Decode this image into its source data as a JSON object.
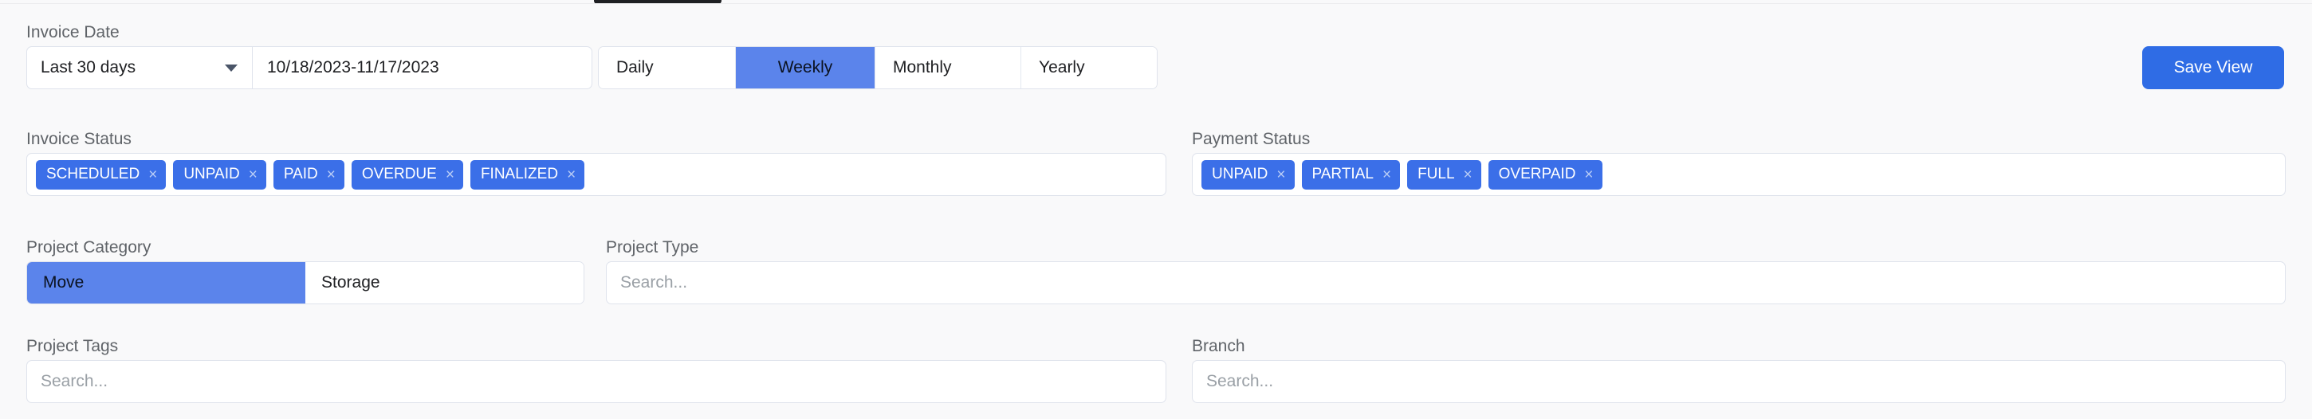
{
  "invoice_date": {
    "label": "Invoice Date",
    "preset_value": "Last 30 days",
    "range_value": "10/18/2023-11/17/2023",
    "chevron_icon": "chevron-down-icon"
  },
  "period": {
    "tabs": [
      {
        "label": "Daily",
        "active": false
      },
      {
        "label": "Weekly",
        "active": true
      },
      {
        "label": "Monthly",
        "active": false
      },
      {
        "label": "Yearly",
        "active": false
      }
    ]
  },
  "toolbar": {
    "save_view_label": "Save View"
  },
  "invoice_status": {
    "label": "Invoice Status",
    "chips": [
      {
        "label": "SCHEDULED",
        "remove_icon": "close-icon"
      },
      {
        "label": "UNPAID",
        "remove_icon": "close-icon"
      },
      {
        "label": "PAID",
        "remove_icon": "close-icon"
      },
      {
        "label": "OVERDUE",
        "remove_icon": "close-icon"
      },
      {
        "label": "FINALIZED",
        "remove_icon": "close-icon"
      }
    ]
  },
  "payment_status": {
    "label": "Payment Status",
    "chips": [
      {
        "label": "UNPAID",
        "remove_icon": "close-icon"
      },
      {
        "label": "PARTIAL",
        "remove_icon": "close-icon"
      },
      {
        "label": "FULL",
        "remove_icon": "close-icon"
      },
      {
        "label": "OVERPAID",
        "remove_icon": "close-icon"
      }
    ]
  },
  "project_category": {
    "label": "Project Category",
    "tabs": [
      {
        "label": "Move",
        "active": true
      },
      {
        "label": "Storage",
        "active": false
      }
    ]
  },
  "project_type": {
    "label": "Project Type",
    "placeholder": "Search...",
    "value": ""
  },
  "project_tags": {
    "label": "Project Tags",
    "placeholder": "Search...",
    "value": ""
  },
  "branch": {
    "label": "Branch",
    "placeholder": "Search...",
    "value": ""
  },
  "colors": {
    "accent_blue": "#3b6fe8",
    "tab_active_blue": "#5b84eb",
    "save_button_blue": "#2f6ce5",
    "panel_background": "#f9f9fa",
    "control_border": "#dfe3ec",
    "label_text": "#5f6368",
    "placeholder_text": "#9aa0a6"
  },
  "close_glyph": "×"
}
